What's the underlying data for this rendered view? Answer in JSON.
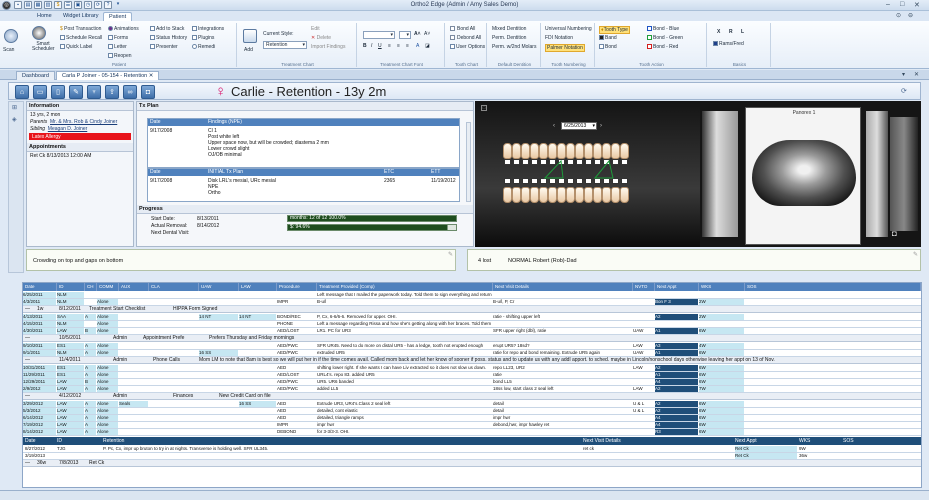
{
  "app": {
    "title": "Ortho2 Edge (Admin / Amy Sales Demo)"
  },
  "ribbon_tabs": [
    "Home",
    "Widget Library",
    "Patient"
  ],
  "ribbon": {
    "patient_group": {
      "label": "Patient",
      "scan": "Scan",
      "smart_scheduler": "Smart Scheduler",
      "items": [
        "Post Transaction",
        "Schedule Recall",
        "Quick Label",
        "Animations",
        "Forms",
        "Letter",
        "Reopen",
        "Add to Stack",
        "Status History",
        "Presenter",
        "Integrations",
        "Plugins",
        "Remedi"
      ]
    },
    "treatment_chart": {
      "label": "Treatment Chart",
      "add": "Add",
      "current_style_label": "Current Style:",
      "current_style_value": "Retention",
      "edit": "Edit",
      "delete": "Delete",
      "import": "Import Findings"
    },
    "tooth_chart_font": {
      "label": "Treatment Chart Font"
    },
    "tooth_chart": {
      "label": "Tooth Chart",
      "items": [
        "Bond All",
        "Debond All",
        "User Options"
      ]
    },
    "default_dentition": {
      "label": "Default Dentition",
      "items": [
        "Mixed Dentition",
        "Perm. Dentition",
        "Perm. w/2nd Molars"
      ]
    },
    "tooth_numbering": {
      "label": "Tooth Numbering",
      "items": [
        "Universal Numbering",
        "FDI Notation",
        "Palmer Notation"
      ]
    },
    "tooth_action": {
      "label": "Tooth Action",
      "items": [
        "Tooth Type",
        "Band",
        "Bond",
        "Bond - Blue",
        "Bond - Green",
        "Bond - Red"
      ]
    },
    "basics": {
      "label": "Basics",
      "letters": [
        "X",
        "R",
        "L"
      ],
      "item": "Rams/Fred"
    }
  },
  "doc_tabs": [
    "Dashboard",
    "Carla P Joiner - 05-154 - Retention"
  ],
  "patient": {
    "name": "Carlie - Retention - 13y 2m"
  },
  "info": {
    "header": "Information",
    "age": "13 yrs, 2 mon",
    "parents_label": "Parents",
    "parents": "Mr. & Mrs. Rob & Cindy Joiner",
    "sibling_label": "Sibling",
    "sibling": "Meagan D. Joiner",
    "alert": "Latex Allergy",
    "appointments_header": "Appointments",
    "appt": "Ret Ck    8/13/2013 12:00 AM"
  },
  "txplan": {
    "header": "Tx Plan",
    "col_date": "Date",
    "col_findings": "Findings (NPE)",
    "findings_date": "9/17/2008",
    "findings": [
      "Cl 1",
      "Post white left",
      "Upper space now, but will be crowded; diastema 2 mm",
      "Lower crowd slight",
      "OJ/OB minimal"
    ],
    "col_initial": "INITIAL Tx Plan",
    "col_etc": "ETC",
    "col_ett": "ETT",
    "init_date": "9/17/2008",
    "init_plan": [
      "Disk LRL's mesial, URc mesial",
      "NPE",
      "Ortho"
    ],
    "etc": "2365",
    "ett": "11/19/2012",
    "progress_header": "Progress",
    "start_label": "Start Date:",
    "start": "8/13/2011",
    "removal_label": "Actual Removal:",
    "removal": "8/14/2012",
    "next_label": "Next Dental Visit:",
    "bar1": "months: 12 of 12   100.0%",
    "bar2": "$:  94.6%"
  },
  "tooth_chart_date": "6/25/2013",
  "xray_title": "Panorex 1",
  "notes": {
    "left": "Crowding on top and gaps on bottom",
    "right_a": "4 lost",
    "right_b": "NORMAL  Robert (Rob)-Dad"
  },
  "grid": {
    "top_note": "Left message that I mailed the paperwork today.  Told them to sign everything and return with payment ASAP.",
    "headers": [
      "Date",
      "ID",
      "CH",
      "COMM",
      "AUX",
      "CLA",
      "UAW",
      "LAW",
      "Procedure",
      "Treatment Provided (Comp)",
      "Next Visit Details",
      "NVTO",
      "Next Appt",
      "WKS",
      "SOS"
    ],
    "rows": [
      {
        "date": "6/25/2011",
        "id": "NLM",
        "ch": "",
        "comm": "",
        "aux": "",
        "cla": "",
        "uaw": "",
        "law": "",
        "proc": "",
        "tx": "Left message that I mailed the paperwork today.  Told them to sign everything and return with payment ASAP.",
        "nvd": "",
        "nvto": "",
        "nappt": "",
        "wks": "",
        "sos": ""
      },
      {
        "date": "4/3/2011",
        "id": "NLM",
        "ch": "",
        "comm": "Alone",
        "aux": "",
        "cla": "",
        "uaw": "",
        "law": "",
        "proc": "IMPR",
        "tx": "B-u/l",
        "nvd": "B-u/l, P, Cr",
        "nvto": "",
        "nappt": "Bon F 3",
        "wks": "2W",
        "sos": ""
      }
    ],
    "band1": {
      "a": "1w",
      "b": "8/12/2011",
      "c": "Treatment Start Checklist",
      "d": "HIPPA Form Signed"
    },
    "rows2": [
      {
        "date": "4/13/2011",
        "id": "SAA",
        "ch": "A",
        "comm": "Alone",
        "aux": "",
        "cla": "",
        "uaw": "14 NT",
        "law": "14 NT",
        "proc": "BOND/REC",
        "tx": "P, Cx, 6-6/6-6.  Removed for upper. OHI.",
        "nvd": "ratie - shifting upper left",
        "nvto": "",
        "nappt": "A2",
        "wks": "2W",
        "sos": ""
      },
      {
        "date": "4/15/2011",
        "id": "NLM",
        "ch": "",
        "comm": "Alone",
        "aux": "",
        "cla": "",
        "uaw": "",
        "law": "",
        "proc": "PHONE",
        "tx": "Left a message regarding Rissa and how she's getting along with her braces.  Told them to call with any questions or concerns.",
        "nvd": "",
        "nvto": "",
        "nappt": "",
        "wks": "",
        "sos": ""
      },
      {
        "date": "4/30/2011",
        "id": "LAW",
        "ch": "B",
        "comm": "Alone",
        "aux": "",
        "cla": "",
        "uaw": "",
        "law": "",
        "proc": "AED/LOST",
        "tx": "LR1. PC for UR3",
        "nvd": "SFR upper right (dbl), ratie",
        "nvto": "UAW",
        "nappt": "A1",
        "wks": "6W",
        "sos": ""
      }
    ],
    "band2": {
      "a": "10/5/2011",
      "b": "Admin",
      "c": "Appointment Prefe",
      "d": "Prefers Thursday and Friday mornings"
    },
    "rows3": [
      {
        "date": "9/10/2011",
        "id": "ES1",
        "ch": "A",
        "comm": "Alone",
        "aux": "",
        "cla": "",
        "uaw": "",
        "law": "",
        "proc": "AED/PWC",
        "tx": "SFR UR45.  Need to do more on distal UR5 - has a ledge, tooth not erupted enough",
        "nvd": "erupt UR5? 18sd?",
        "nvto": "LAW",
        "nappt": "A3",
        "wks": "4W",
        "sos": ""
      },
      {
        "date": "9/1/2011",
        "id": "NLM",
        "ch": "A",
        "comm": "Alone",
        "aux": "",
        "cla": "",
        "uaw": "16 SS",
        "law": "",
        "proc": "AED/PWC",
        "tx": "extruded UR5",
        "nvd": "ratie for repo and bond remaining. Extrude UR5 again",
        "nvto": "UAW",
        "nappt": "A1",
        "wks": "6W",
        "sos": ""
      }
    ],
    "band3": {
      "a": "11/4/2011",
      "b": "Admin",
      "c": "Phone Calls",
      "d": "Mom LM to note that 8am is best so we will put her in if the time comes avail. Called mom back and let her know of sooner if poss. status and to update us with any addl apport. to sched. maybe in Lincoln/nonschool days otherwise leaving her appt on 13 of Nov."
    },
    "rows4": [
      {
        "date": "10/31/2011",
        "id": "ES1",
        "ch": "A",
        "comm": "Alone",
        "aux": "",
        "cla": "",
        "uaw": "",
        "law": "",
        "proc": "AED",
        "tx": "shifting lower right.  If she wants I can have Liv extracted so it does not slow us down.",
        "nvd": "repo LL23, UR2",
        "nvto": "LAW",
        "nappt": "A2",
        "wks": "6W",
        "sos": ""
      },
      {
        "date": "11/29/2011",
        "id": "ES1",
        "ch": "A",
        "comm": "Alone",
        "aux": "",
        "cla": "",
        "uaw": "",
        "law": "",
        "proc": "AED/LOST",
        "tx": "URL4's. repo 83. added UR5",
        "nvd": "ratie",
        "nvto": "",
        "nappt": "A1",
        "wks": "6W",
        "sos": ""
      },
      {
        "date": "12/29/2011",
        "id": "LAW",
        "ch": "B",
        "comm": "Alone",
        "aux": "",
        "cla": "",
        "uaw": "",
        "law": "",
        "proc": "AED/PWC",
        "tx": "UR5. UR6 banded",
        "nvd": "bond LL5",
        "nvto": "",
        "nappt": "A4",
        "wks": "6W",
        "sos": ""
      },
      {
        "date": "2/9/2012",
        "id": "LAW",
        "ch": "A",
        "comm": "Alone",
        "aux": "",
        "cla": "",
        "uaw": "",
        "law": "",
        "proc": "AED/PWC",
        "tx": "added LL5",
        "nvd": "18ss low, start class 2 seal left",
        "nvto": "LAW",
        "nappt": "A2",
        "wks": "7W",
        "sos": ""
      }
    ],
    "band4": {
      "a": "4/12/2012",
      "b": "Admin",
      "c": "Finances",
      "d": "New Credit Card on file"
    },
    "rows5": [
      {
        "date": "3/29/2012",
        "id": "LAW",
        "ch": "A",
        "comm": "Alone",
        "aux": "Seals",
        "cla": "",
        "uaw": "",
        "law": "16 SS",
        "proc": "AED",
        "tx": "Extrude UR3, UR4's.Class 2 seal left",
        "nvd": "detail",
        "nvto": "U & L",
        "nappt": "A2",
        "wks": "6W",
        "sos": ""
      },
      {
        "date": "5/3/2012",
        "id": "LAW",
        "ch": "A",
        "comm": "Alone",
        "aux": "",
        "cla": "",
        "uaw": "",
        "law": "",
        "proc": "AED",
        "tx": "detailed, cont elastic",
        "nvd": "detail",
        "nvto": "U & L",
        "nappt": "A2",
        "wks": "6W",
        "sos": ""
      },
      {
        "date": "6/14/2012",
        "id": "LAW",
        "ch": "A",
        "comm": "Alone",
        "aux": "",
        "cla": "",
        "uaw": "",
        "law": "",
        "proc": "AED",
        "tx": "detailed, triangle ramps",
        "nvd": "impr hwr",
        "nvto": "",
        "nappt": "A4",
        "wks": "6W",
        "sos": ""
      },
      {
        "date": "7/19/2012",
        "id": "LAW",
        "ch": "A",
        "comm": "Alone",
        "aux": "",
        "cla": "",
        "uaw": "",
        "law": "",
        "proc": "IMPR",
        "tx": "impr hwr",
        "nvd": "debond,hwr, impr hawley ret",
        "nvto": "",
        "nappt": "A4",
        "wks": "6W",
        "sos": ""
      },
      {
        "date": "8/14/2012",
        "id": "LAW",
        "ch": "A",
        "comm": "Alone",
        "aux": "",
        "cla": "",
        "uaw": "",
        "law": "",
        "proc": "DEBOND",
        "tx": "for 3-3/3-3. OHI.",
        "nvd": "",
        "nvto": "",
        "nappt": "R3",
        "wks": "6W",
        "sos": ""
      }
    ],
    "bottom_headers": [
      "Date",
      "ID",
      "Retention",
      "Next Visit Details",
      "Next Appt",
      "WKS",
      "SOS"
    ],
    "bottom_rows": [
      {
        "date": "8/27/2012",
        "id": "TJG",
        "ret": "P. Pc, Cx, impr up bruton to try in at nights.  Transverse is holding well. SFR UL345.",
        "nvd": "ret ck",
        "nappt": "Ret Ck",
        "wks": "9W"
      },
      {
        "date": "3/19/2013",
        "id": "",
        "ret": "",
        "nvd": "",
        "nappt": "Ret Ck",
        "wks": "36w"
      }
    ],
    "band5": {
      "a": "36w",
      "b": "7/8/2013",
      "c": "Ret Ck"
    }
  },
  "colors": {
    "accent": "#4f81bd",
    "dark": "#1f4e79",
    "cyan": "#c6e7f2",
    "green": "#8ac04b",
    "alert": "#e8141b",
    "female": "#d9146b"
  }
}
